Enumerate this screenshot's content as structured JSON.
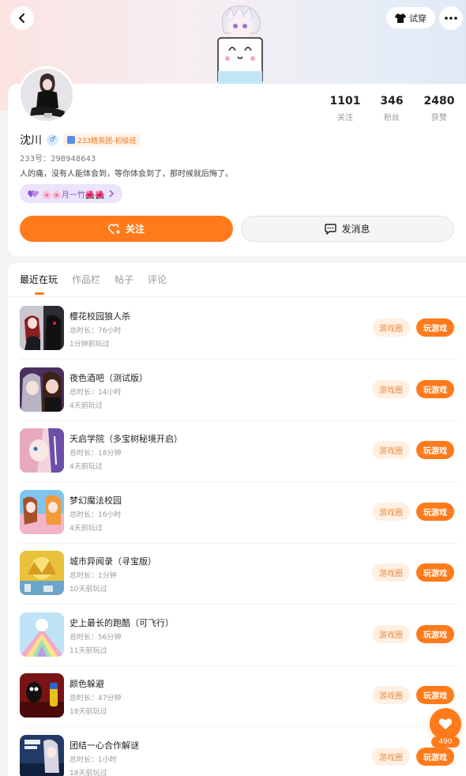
{
  "header": {
    "try_on_label": "试穿"
  },
  "profile": {
    "stats": [
      {
        "value": "1101",
        "label": "关注"
      },
      {
        "value": "346",
        "label": "粉丝"
      },
      {
        "value": "2480",
        "label": "获赞"
      }
    ],
    "name": "沈川",
    "gender_symbol": "♂",
    "badge_label": "233精英团-初级班",
    "uid": "233号：298948643",
    "bio": "人的痛，没有人能体会到，等你体会到了，那时候就后悔了。",
    "tag_label": "🌸🌸月一竹🌺🌺",
    "follow_label": "关注",
    "message_label": "发消息"
  },
  "tabs": [
    {
      "label": "最近在玩"
    },
    {
      "label": "作品栏"
    },
    {
      "label": "帖子"
    },
    {
      "label": "评论"
    }
  ],
  "games": [
    {
      "title": "樱花校园狼人杀",
      "duration": "总时长：76小时",
      "last_played": "1分钟前玩过",
      "circle_label": "游戏圈",
      "play_label": "玩游戏"
    },
    {
      "title": "夜色酒吧（测试版）",
      "duration": "总时长：14小时",
      "last_played": "4天前玩过",
      "circle_label": "游戏圈",
      "play_label": "玩游戏"
    },
    {
      "title": "天启学院（多宝树秘境开启）",
      "duration": "总时长：18分钟",
      "last_played": "4天前玩过",
      "circle_label": "游戏圈",
      "play_label": "玩游戏"
    },
    {
      "title": "梦幻魔法校园",
      "duration": "总时长：16小时",
      "last_played": "4天前玩过",
      "circle_label": "游戏圈",
      "play_label": "玩游戏"
    },
    {
      "title": "城市异闻录（寻宝版）",
      "duration": "总时长：1分钟",
      "last_played": "10天前玩过",
      "circle_label": "游戏圈",
      "play_label": "玩游戏"
    },
    {
      "title": "史上最长的跑酷（可飞行）",
      "duration": "总时长：56分钟",
      "last_played": "11天前玩过",
      "circle_label": "游戏圈",
      "play_label": "玩游戏"
    },
    {
      "title": "颜色躲避",
      "duration": "总时长：47分钟",
      "last_played": "18天前玩过",
      "circle_label": "游戏圈",
      "play_label": "玩游戏"
    },
    {
      "title": "团结一心合作解谜",
      "duration": "总时长：1小时",
      "last_played": "18天前玩过",
      "circle_label": "游戏圈",
      "play_label": "玩游戏"
    }
  ],
  "fab": {
    "count": "490"
  },
  "colors": {
    "accent": "#ff7a1a",
    "circle_bg": "#fff0e3",
    "tag_bg": "#ebe4fb"
  }
}
